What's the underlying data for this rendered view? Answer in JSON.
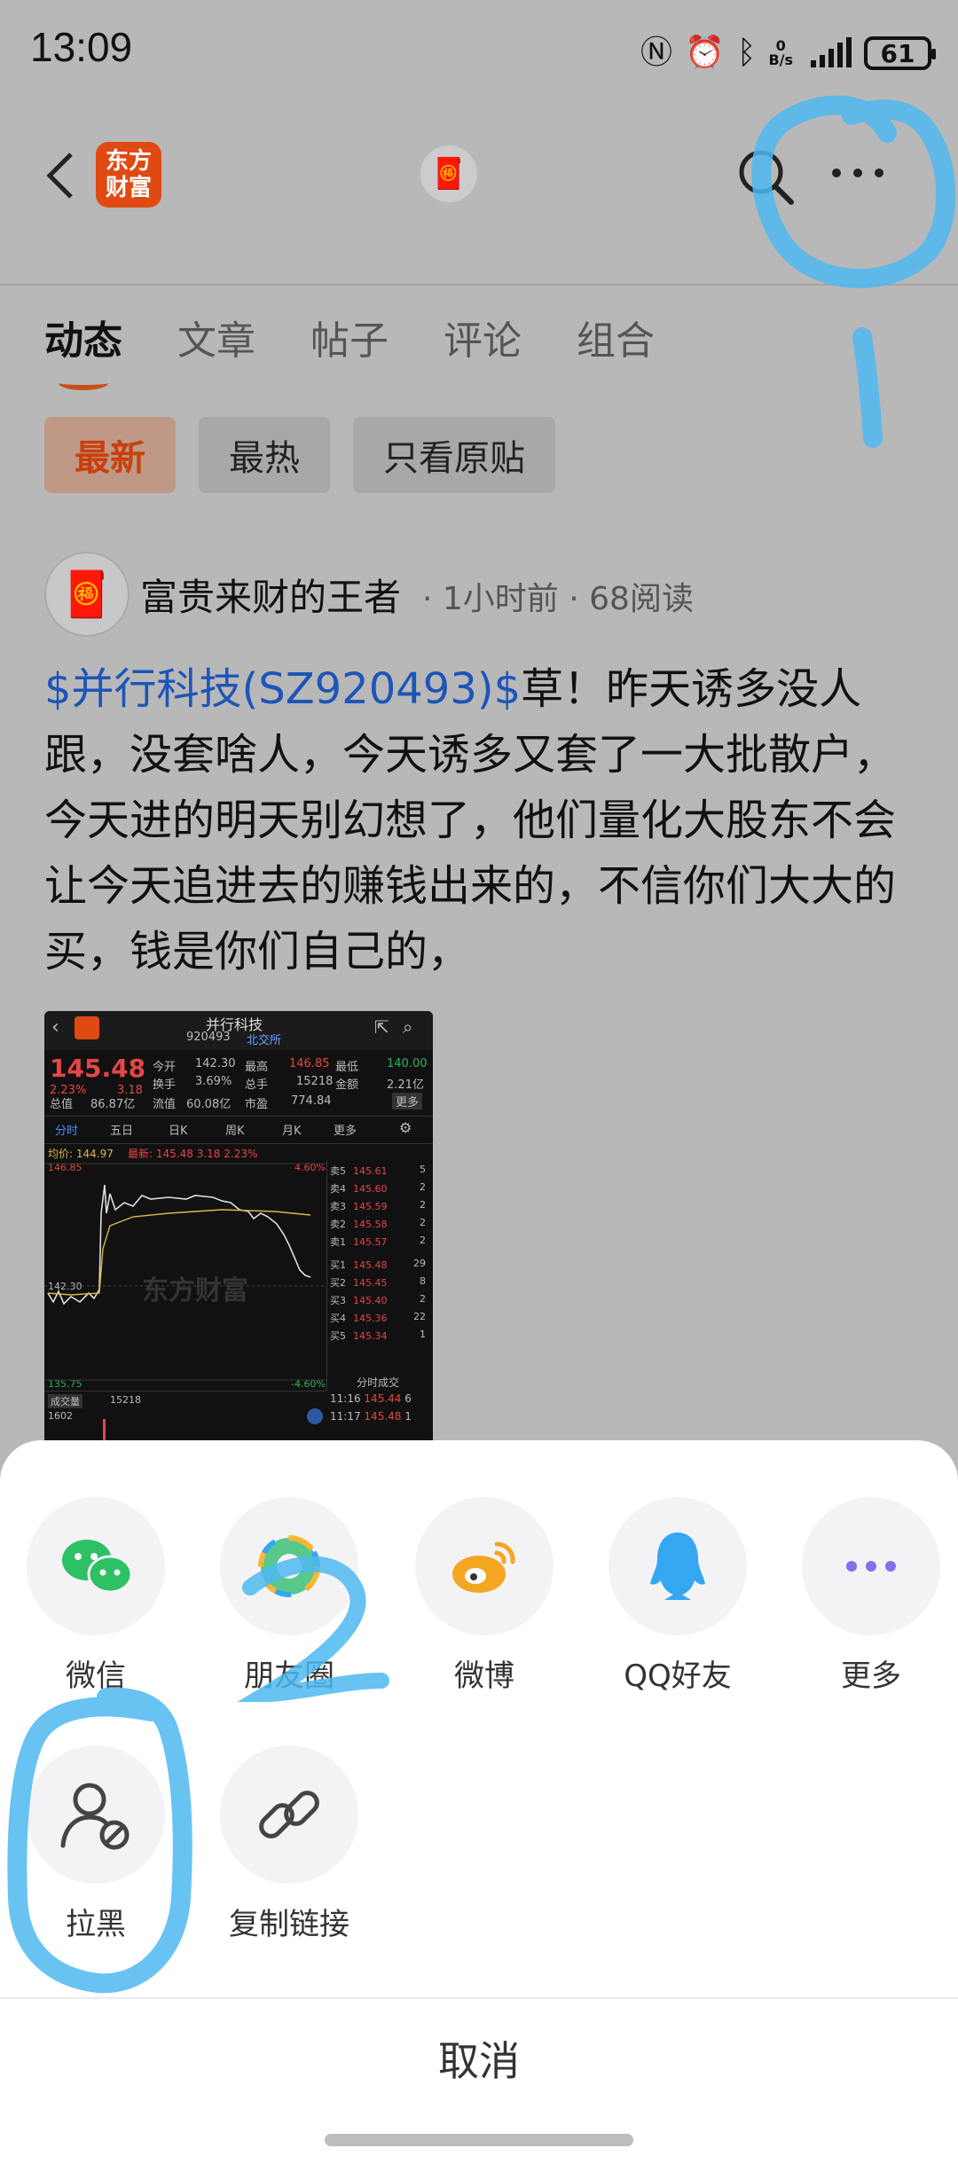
{
  "status_bar": {
    "time": "13:09",
    "net_speed_value": "0",
    "net_speed_unit": "B/s",
    "battery": "61"
  },
  "header": {
    "logo_line1": "东方",
    "logo_line2": "财富"
  },
  "tabs": [
    {
      "label": "动态",
      "active": true
    },
    {
      "label": "文章"
    },
    {
      "label": "帖子"
    },
    {
      "label": "评论"
    },
    {
      "label": "组合"
    }
  ],
  "filters": [
    {
      "label": "最新",
      "active": true
    },
    {
      "label": "最热"
    },
    {
      "label": "只看原贴"
    }
  ],
  "post": {
    "author": "富贵来财的王者",
    "time": "1小时前",
    "reads": "68阅读",
    "stock_tag": "$并行科技(SZ920493)$",
    "body": "草！昨天诱多没人跟，没套啥人，今天诱多又套了一大批散户，今天进的明天别幻想了，他们量化大股东不会让今天追进去的赚钱出来的，不信你们大大的买，钱是你们自己的，"
  },
  "thumbnail": {
    "name": "并行科技",
    "code": "920493",
    "exchange": "北交所",
    "price": "145.48",
    "change_pct": "2.23%",
    "change": "3.18",
    "open_label": "今开",
    "open": "142.30",
    "high_label": "最高",
    "high": "146.85",
    "low_label": "最低",
    "low": "140.00",
    "turnover_label": "换手",
    "turnover": "3.69%",
    "volume_label": "总手",
    "volume": "15218",
    "amount_label": "金额",
    "amount": "2.21亿",
    "total_value_label": "总值",
    "total_value": "86.87亿",
    "float_label": "流值",
    "float_value": "60.08亿",
    "pe_label": "市盈",
    "pe": "774.84",
    "more": "更多",
    "chart_tabs": [
      "分时",
      "五日",
      "日K",
      "周K",
      "月K",
      "更多"
    ],
    "avg_label": "均价:",
    "avg": "144.97",
    "latest_label": "最新:",
    "latest": "145.48",
    "latest_change": "3.18",
    "latest_pct": "2.23%",
    "y_top": "146.85",
    "y_mid": "142.30",
    "y_bottom": "135.75",
    "pct_top": "4.60%",
    "pct_bottom": "-4.60%",
    "vol_label": "成交量",
    "vol_value": "15218",
    "vol_axis": "1602",
    "trade_label": "分时成交",
    "asks": [
      {
        "label": "卖5",
        "price": "145.61",
        "qty": "5"
      },
      {
        "label": "卖4",
        "price": "145.60",
        "qty": "2"
      },
      {
        "label": "卖3",
        "price": "145.59",
        "qty": "2"
      },
      {
        "label": "卖2",
        "price": "145.58",
        "qty": "2"
      },
      {
        "label": "卖1",
        "price": "145.57",
        "qty": "2"
      }
    ],
    "bids": [
      {
        "label": "买1",
        "price": "145.48",
        "qty": "29"
      },
      {
        "label": "买2",
        "price": "145.45",
        "qty": "8"
      },
      {
        "label": "买3",
        "price": "145.40",
        "qty": "2"
      },
      {
        "label": "买4",
        "price": "145.36",
        "qty": "22"
      },
      {
        "label": "买5",
        "price": "145.34",
        "qty": "1"
      }
    ],
    "trades": [
      {
        "time": "11:16",
        "price": "145.44",
        "qty": "6"
      },
      {
        "time": "11:17",
        "price": "145.48",
        "qty": "1"
      }
    ],
    "watermark": "东方财富"
  },
  "share_sheet": {
    "row1": [
      {
        "label": "微信",
        "icon": "wechat-icon"
      },
      {
        "label": "朋友圈",
        "icon": "moments-icon"
      },
      {
        "label": "微博",
        "icon": "weibo-icon"
      },
      {
        "label": "QQ好友",
        "icon": "qq-icon"
      },
      {
        "label": "更多",
        "icon": "more-dots-icon"
      }
    ],
    "row2": [
      {
        "label": "拉黑",
        "icon": "block-user-icon"
      },
      {
        "label": "复制链接",
        "icon": "link-icon"
      }
    ],
    "cancel": "取消"
  },
  "annotations": {
    "mark_1": "1",
    "mark_2": "2",
    "color": "#4db8f0"
  },
  "colors": {
    "accent": "#e04a12",
    "stock_link": "#1d55b8",
    "wechat": "#2dc163",
    "weibo": "#f4a623",
    "qq": "#35a6f2",
    "more": "#7b73e6"
  }
}
